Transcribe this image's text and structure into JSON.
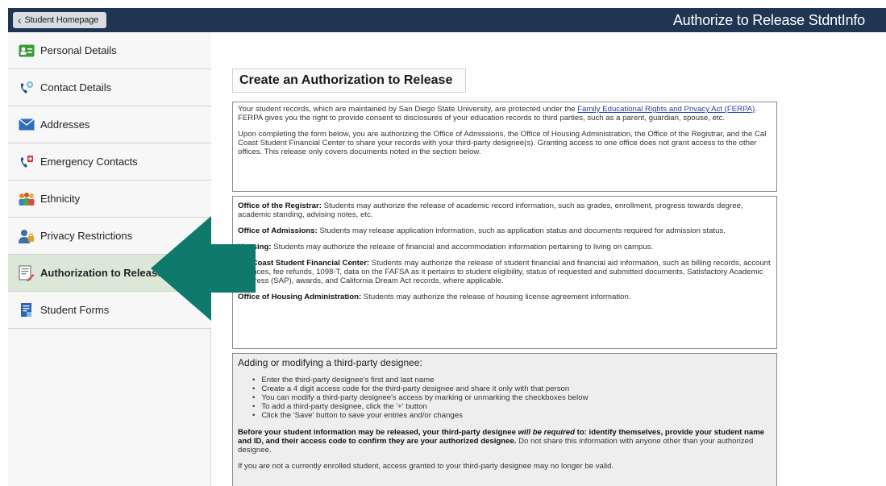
{
  "header": {
    "back_label": "Student Homepage",
    "title": "Authorize to Release StdntInfo",
    "bg_color": "#1f3552"
  },
  "sidebar": {
    "items": [
      {
        "label": "Personal Details",
        "icon": "id-card-icon"
      },
      {
        "label": "Contact Details",
        "icon": "phone-contact-icon"
      },
      {
        "label": "Addresses",
        "icon": "envelope-icon"
      },
      {
        "label": "Emergency Contacts",
        "icon": "emergency-phone-icon"
      },
      {
        "label": "Ethnicity",
        "icon": "people-group-icon"
      },
      {
        "label": "Privacy Restrictions",
        "icon": "user-lock-icon"
      },
      {
        "label": "Authorization to Release",
        "icon": "document-authorization-icon",
        "active": true
      },
      {
        "label": "Student Forms",
        "icon": "forms-icon"
      }
    ],
    "active_color": "#dbe8d7"
  },
  "main": {
    "heading": "Create an Authorization to Release",
    "intro": {
      "p1_before": "Your student records, which are maintained by San Diego State University, are protected under the ",
      "p1_link": "Family Educational Rights and Privacy Act (FERPA)",
      "p1_after": ". FERPA gives you the right to provide consent to disclosures of your education records to third parties, such as a parent, guardian, spouse, etc.",
      "p2": "Upon completing the form below, you are authorizing the Office of Admissions, the Office of Housing Administration, the Office of the Registrar, and the Cal Coast Student Financial Center to share your records with your third-party designee(s). Granting access to one office does not grant access to the other offices. This release only covers documents noted in the section below."
    },
    "offices": [
      {
        "name": "Office of the Registrar:",
        "text": " Students may authorize the release of academic record information, such as grades, enrollment, progress towards degree, academic standing, advising notes, etc."
      },
      {
        "name": "Office of Admissions:",
        "text": " Students may release application information, such as application status and documents required for admission status."
      },
      {
        "name": "Housing:",
        "text": " Students may authorize the release of financial and accommodation information pertaining to living on campus."
      },
      {
        "name": "Cal Coast Student Financial Center:",
        "text": " Students may authorize the release of student financial and financial aid information, such as billing records, account balances, fee refunds, 1098-T, data on the FAFSA as it pertains to student eligibility, status of requested and submitted documents, Satisfactory Academic Progress (SAP), awards, and California Dream Act records, where applicable."
      },
      {
        "name": "Office of Housing Administration:",
        "text": " Students may authorize the release of housing license agreement information."
      }
    ],
    "designee": {
      "title": "Adding or modifying a third-party designee:",
      "bullets": [
        "Enter the third-party designee's first and last name",
        "Create a 4 digit access code for the third-party designee and share it only with that person",
        "You can modify a third-party designee's access by marking or unmarking the checkboxes below",
        "To add a third-party designee, click the '+' button",
        "Click the 'Save' button to save your entries and/or changes"
      ],
      "warn_a": "Before your student information may be released, your third-party designee ",
      "warn_em": "will be required",
      "warn_b": " to: identify themselves, provide your student name and ID, and their access code to confirm they are your authorized designee.",
      "warn_tail": " Do not share this information with anyone other than your authorized designee.",
      "cutoff": "If you are not a currently enrolled student, access granted to your third-party designee may no longer be valid."
    }
  },
  "annotation": {
    "arrow_color": "#0f7a6c",
    "icon": "left-arrow-icon"
  }
}
